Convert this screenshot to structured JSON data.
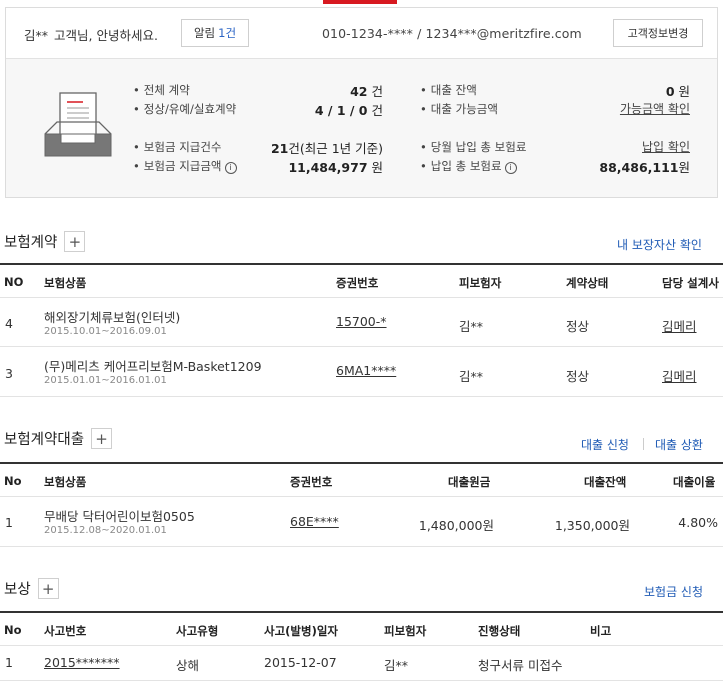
{
  "summary": {
    "greeting_name": "김**",
    "greeting_text": "고객님, 안녕하세요.",
    "alarm_label": "알림",
    "alarm_count": "1건",
    "contact": "010-1234-**** / 1234***@meritzfire.com",
    "change_button": "고객정보변경",
    "items": {
      "total_contract_label": "전체 계약",
      "total_contract_num": "42",
      "total_contract_unit": " 건",
      "status_label": "정상/유예/실효계약",
      "status_value": "4 / 1 / 0",
      "status_unit": " 건",
      "claims_count_label": "보험금 지급건수",
      "claims_count_num": "21",
      "claims_count_note": "건(최근 1년 기준)",
      "claims_amount_label": "보험금 지급금액",
      "claims_amount_num": "11,484,977",
      "claims_amount_unit": " 원",
      "loan_balance_label": "대출 잔액",
      "loan_balance_num": "0",
      "loan_balance_unit": " 원",
      "loan_available_label": "대출 가능금액",
      "loan_available_link": "가능금액 확인",
      "month_premium_label": "당월 납입 총 보험료",
      "month_premium_link": "납입 확인",
      "total_premium_label": "납입 총 보험료",
      "total_premium_num": "88,486,111",
      "total_premium_unit": "원"
    }
  },
  "contracts": {
    "title": "보험계약",
    "link": "내 보장자산 확인",
    "headers": [
      "NO",
      "보험상품",
      "증권번호",
      "피보험자",
      "계약상태",
      "담당 설계사"
    ],
    "rows": [
      {
        "no": "4",
        "product": "해외장기체류보험(인터넷)",
        "period": "2015.10.01~2016.09.01",
        "policy": "15700-*",
        "insured": "김**",
        "status": "정상",
        "agent": "김메리"
      },
      {
        "no": "3",
        "product": "(무)메리츠 케어프리보험M-Basket1209",
        "period": "2015.01.01~2016.01.01",
        "policy": "6MA1****",
        "insured": "김**",
        "status": "정상",
        "agent": "김메리"
      }
    ]
  },
  "loans": {
    "title": "보험계약대출",
    "link_apply": "대출 신청",
    "link_repay": "대출 상환",
    "headers": [
      "No",
      "보험상품",
      "증권번호",
      "대출원금",
      "대출잔액",
      "대출이율"
    ],
    "rows": [
      {
        "no": "1",
        "product": "무배당 닥터어린이보험0505",
        "period": "2015.12.08~2020.01.01",
        "policy": "68E****",
        "principal": "1,480,000원",
        "balance": "1,350,000원",
        "rate": "4.80%"
      }
    ]
  },
  "compensation": {
    "title": "보상",
    "link": "보험금 신청",
    "headers": [
      "No",
      "사고번호",
      "사고유형",
      "사고(발병)일자",
      "피보험자",
      "진행상태",
      "비고"
    ],
    "rows": [
      {
        "no": "1",
        "accident_no": "2015*******",
        "type": "상해",
        "date": "2015-12-07",
        "insured": "김**",
        "progress": "청구서류 미접수",
        "note": ""
      }
    ]
  },
  "icons": {
    "tray": "document-tray-icon",
    "info": "info-circle-icon",
    "plus": "plus-icon"
  },
  "colors": {
    "accent": "#d71920",
    "link_blue": "#1f5bb5",
    "count_blue": "#2a64c5"
  }
}
